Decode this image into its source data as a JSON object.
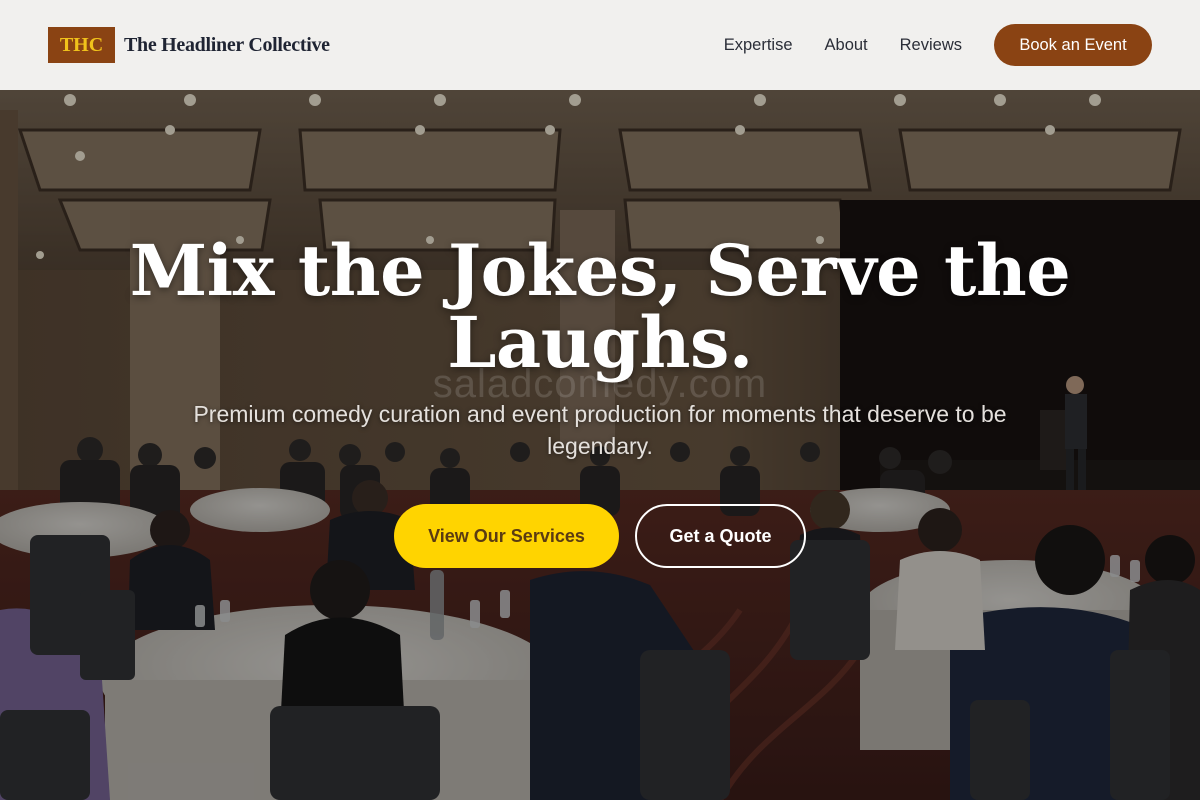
{
  "header": {
    "logo_text": "THC",
    "brand_name": "The Headliner Collective",
    "nav": [
      {
        "label": "Expertise"
      },
      {
        "label": "About"
      },
      {
        "label": "Reviews"
      }
    ],
    "cta_label": "Book an Event"
  },
  "hero": {
    "headline": "Mix the Jokes, Serve the Laughs.",
    "subheadline": "Premium comedy curation and event production for moments that deserve to be legendary.",
    "watermark": "saladcomedy.com",
    "primary_button": "View Our Services",
    "secondary_button": "Get a Quote",
    "background_description_icon": "ballroom-event-photo"
  },
  "colors": {
    "brand_brown": "#8a4313",
    "logo_gold": "#f1c21b",
    "primary_yellow": "#ffd400",
    "header_bg": "#f1f0ee"
  }
}
